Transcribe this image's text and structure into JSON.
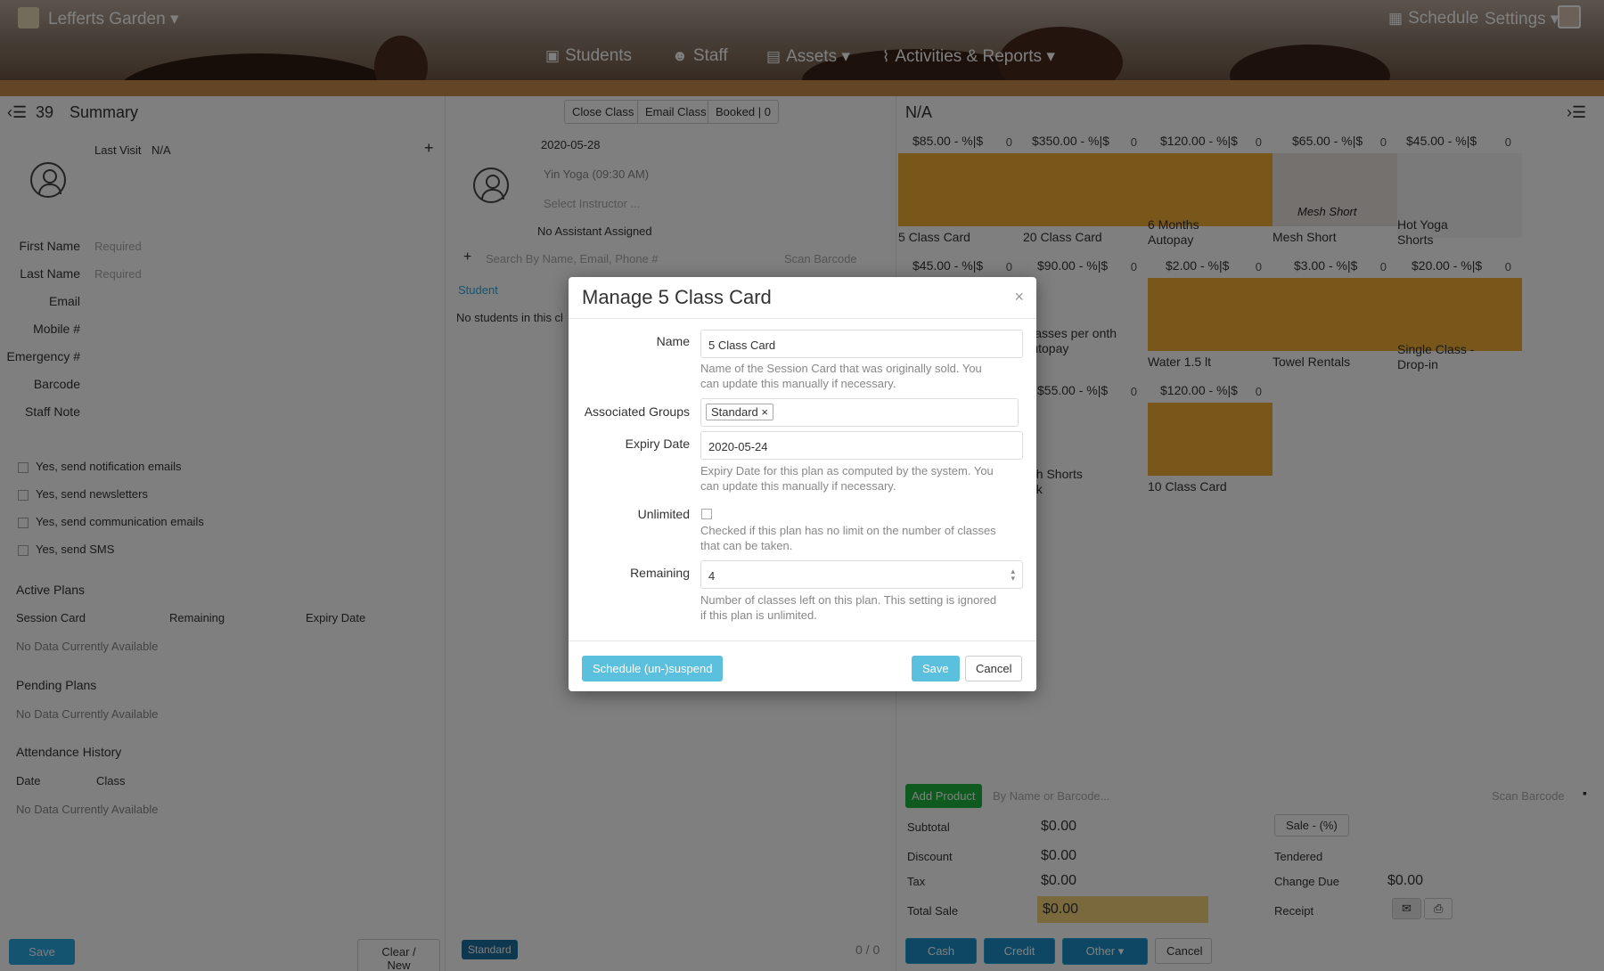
{
  "header": {
    "brand": "Lefferts Garden",
    "nav": [
      "Students",
      "Staff",
      "Assets",
      "Activities & Reports"
    ],
    "schedule": "Schedule",
    "settings": "Settings"
  },
  "left": {
    "count": "39",
    "title": "Summary",
    "last_visit_label": "Last Visit",
    "last_visit_value": "N/A",
    "fields": [
      "First Name",
      "Last Name",
      "Email",
      "Mobile #",
      "Emergency #",
      "Barcode",
      "Staff Note"
    ],
    "required": "Required",
    "checks": [
      "Yes, send notification emails",
      "Yes, send newsletters",
      "Yes, send communication emails",
      "Yes, send SMS"
    ],
    "active_plans": "Active Plans",
    "plan_cols": [
      "Session Card",
      "Remaining",
      "Expiry Date"
    ],
    "no_data": "No Data Currently Available",
    "pending_plans": "Pending Plans",
    "attendance": "Attendance History",
    "att_cols": [
      "Date",
      "Class"
    ],
    "save": "Save",
    "clear": "Clear / New"
  },
  "middle": {
    "close_class": "Close Class",
    "email_class": "Email Class",
    "booked": "Booked | 0",
    "date": "2020-05-28",
    "class_name": "Yin Yoga (09:30 AM)",
    "instructor": "Select Instructor ...",
    "assistant": "No Assistant Assigned",
    "search_placeholder": "Search By Name, Email, Phone #",
    "scan": "Scan Barcode",
    "student_col": "Student",
    "no_students": "No students in this cl",
    "tag": "Standard",
    "count": "0 / 0"
  },
  "right": {
    "title": "N/A",
    "products": [
      {
        "price": "$85.00",
        "disc": "- %|$",
        "qty": "0",
        "name": "5 Class Card"
      },
      {
        "price": "$350.00",
        "disc": "- %|$",
        "qty": "0",
        "name": "20 Class Card"
      },
      {
        "price": "$120.00",
        "disc": "- %|$",
        "qty": "0",
        "name": "6 Months Autopay"
      },
      {
        "price": "$65.00",
        "disc": "- %|$",
        "qty": "0",
        "name": "Mesh Short"
      },
      {
        "price": "$45.00",
        "disc": "- %|$",
        "qty": "0",
        "name": "Hot Yoga Shorts"
      },
      {
        "price": "$45.00",
        "disc": "- %|$",
        "qty": "0",
        "name": ""
      },
      {
        "price": "$90.00",
        "disc": "- %|$",
        "qty": "0",
        "name": "Classes per onth Autopay"
      },
      {
        "price": "$2.00",
        "disc": "- %|$",
        "qty": "0",
        "name": "Water 1.5 lt"
      },
      {
        "price": "$3.00",
        "disc": "- %|$",
        "qty": "0",
        "name": "Towel Rentals"
      },
      {
        "price": "$20.00",
        "disc": "- %|$",
        "qty": "0",
        "name": "Single Class - Drop-in"
      },
      {
        "price": "$55.00",
        "disc": "- %|$",
        "qty": "0",
        "name": "esh Shorts ack"
      },
      {
        "price": "$120.00",
        "disc": "- %|$",
        "qty": "0",
        "name": "10 Class Card"
      }
    ],
    "mesh_short_overlay": "Mesh Short",
    "add_product": "Add Product",
    "by_name": "By Name or Barcode...",
    "scan": "Scan Barcode",
    "subtotal": "Subtotal",
    "subtotal_v": "$0.00",
    "discount": "Discount",
    "discount_v": "$0.00",
    "tax": "Tax",
    "tax_v": "$0.00",
    "total": "Total Sale",
    "total_v": "$0.00",
    "sale": "Sale - (%)",
    "tendered": "Tendered",
    "change_due": "Change Due",
    "change_due_v": "$0.00",
    "receipt": "Receipt",
    "cash": "Cash",
    "credit": "Credit",
    "other": "Other",
    "cancel": "Cancel"
  },
  "modal": {
    "title": "Manage 5 Class Card",
    "name_label": "Name",
    "name_value": "5 Class Card",
    "name_help": "Name of the Session Card that was originally sold. You can update this manually if necessary.",
    "groups_label": "Associated Groups",
    "group_tag": "Standard",
    "expiry_label": "Expiry Date",
    "expiry_value": "2020-05-24",
    "expiry_help": "Expiry Date for this plan as computed by the system. You can update this manually if necessary.",
    "unlimited_label": "Unlimited",
    "unlimited_help": "Checked if this plan has no limit on the number of classes that can be taken.",
    "remaining_label": "Remaining",
    "remaining_value": "4",
    "remaining_help": "Number of classes left on this plan. This setting is ignored if this plan is unlimited.",
    "suspend_btn": "Schedule (un-)suspend",
    "save_btn": "Save",
    "cancel_btn": "Cancel"
  }
}
